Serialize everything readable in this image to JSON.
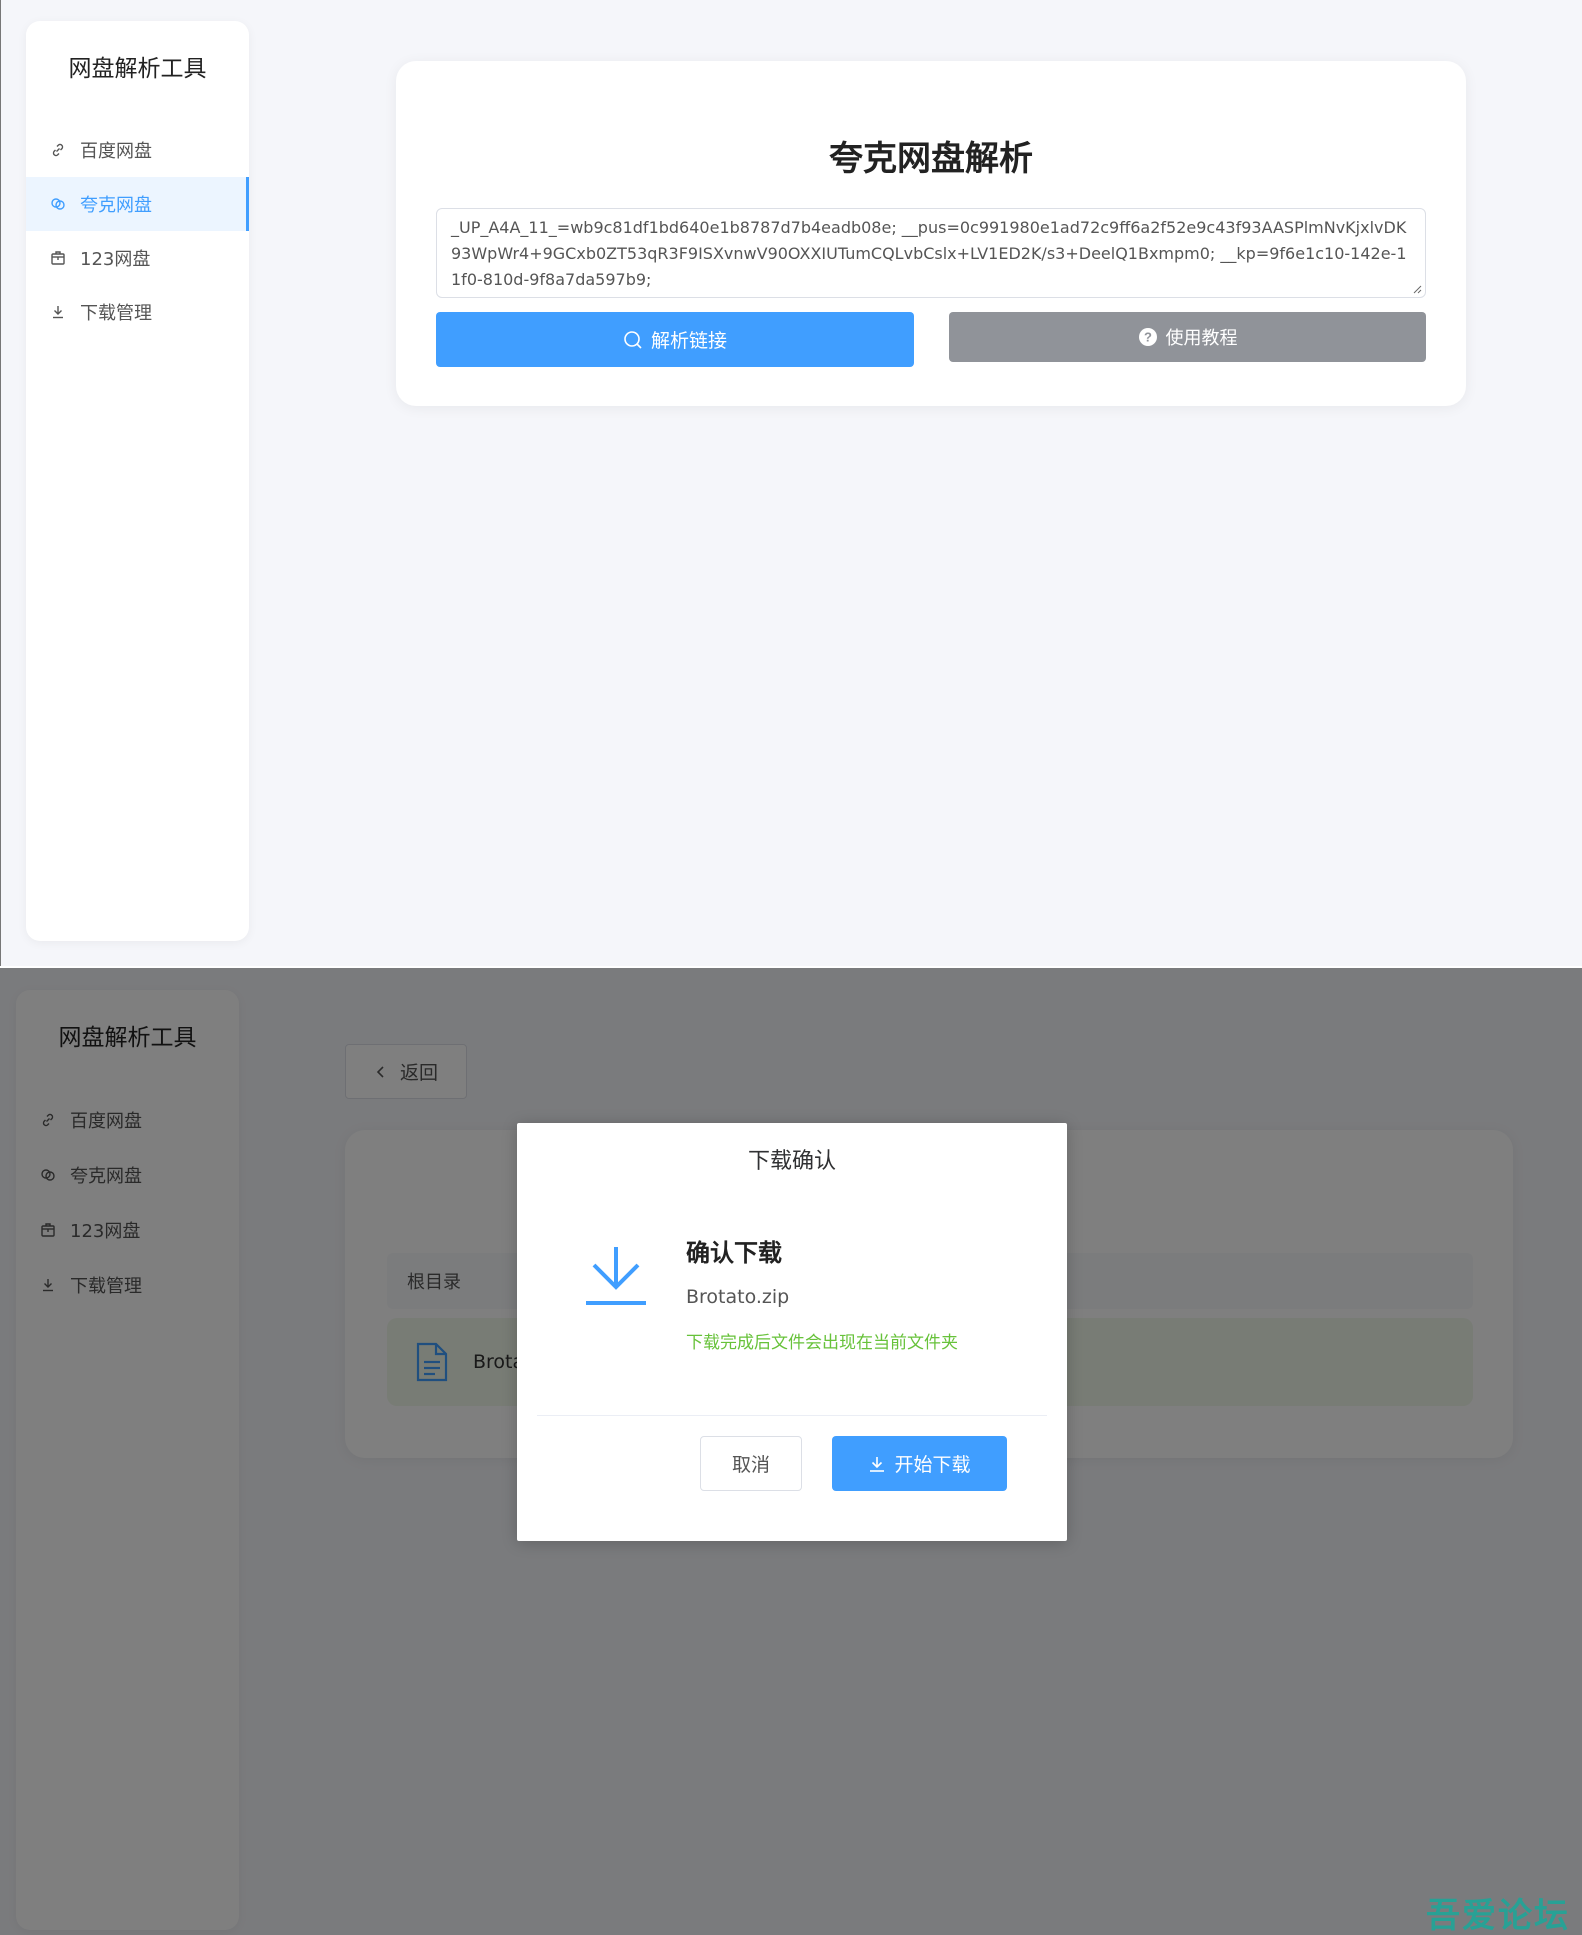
{
  "sidebar": {
    "title": "网盘解析工具",
    "items": [
      {
        "label": "百度网盘",
        "icon": "link-icon"
      },
      {
        "label": "夸克网盘",
        "icon": "cloud-link-icon"
      },
      {
        "label": "123网盘",
        "icon": "box-icon"
      },
      {
        "label": "下载管理",
        "icon": "download-icon"
      }
    ],
    "active_index": 1
  },
  "parse_page": {
    "title": "夸克网盘解析",
    "cookie_value": "_UP_A4A_11_=wb9c81df1bd640e1b8787d7b4eadb08e; __pus=0c991980e1ad72c9ff6a2f52e9c43f93AASPlmNvKjxlvDK93WpWr4+9GCxb0ZT53qR3F9ISXvnwV90OXXIUTumCQLvbCslx+LV1ED2K/s3+DeelQ1Bxmpm0; __kp=9f6e1c10-142e-11f0-810d-9f8a7da597b9;",
    "parse_button": "解析链接",
    "tutorial_button": "使用教程"
  },
  "file_page": {
    "back_button": "返回",
    "breadcrumb": "根目录",
    "file_name_partial": "Brota"
  },
  "dialog": {
    "title": "下载确认",
    "heading": "确认下载",
    "file_name": "Brotato.zip",
    "hint": "下载完成后文件会出现在当前文件夹",
    "cancel_button": "取消",
    "confirm_button": "开始下载"
  },
  "watermark": "吾爱论坛",
  "colors": {
    "primary": "#409eff",
    "gray_button": "#909399",
    "hint_green": "#67c23a",
    "active_bg": "#ecf5ff",
    "page_bg": "#f5f6fa"
  }
}
